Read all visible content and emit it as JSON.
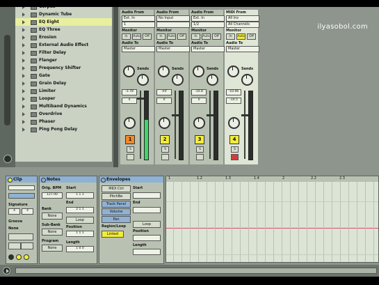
{
  "watermark": "ilyasobol.com",
  "browser": {
    "items": [
      {
        "label": "Corpus"
      },
      {
        "label": "Dynamic Tube"
      },
      {
        "label": "EQ Eight",
        "selected": true
      },
      {
        "label": "EQ Three"
      },
      {
        "label": "Erosion"
      },
      {
        "label": "External Audio Effect"
      },
      {
        "label": "Filter Delay"
      },
      {
        "label": "Flanger"
      },
      {
        "label": "Frequency Shifter"
      },
      {
        "label": "Gate"
      },
      {
        "label": "Grain Delay"
      },
      {
        "label": "Limiter"
      },
      {
        "label": "Looper"
      },
      {
        "label": "Multiband Dynamics"
      },
      {
        "label": "Overdrive"
      },
      {
        "label": "Phaser"
      },
      {
        "label": "Ping Pong Delay"
      }
    ]
  },
  "mixer": {
    "labels": {
      "audio_from": "Audio From",
      "midi_from": "MIDI From",
      "monitor": "Monitor",
      "in": "In",
      "auto": "Auto",
      "off": "Off",
      "audio_to": "Audio To",
      "sends": "Sends",
      "master": "Master",
      "solo": "S"
    },
    "tracks": [
      {
        "from": "Ext. In",
        "channel": "1",
        "volume": "-3.78",
        "pan": "0",
        "number": "1",
        "number_color": "#f08a2b",
        "meter_active": true,
        "selected": false
      },
      {
        "from": "No Input",
        "channel": "",
        "volume": "-Inf",
        "pan": "0",
        "number": "2",
        "number_color": "#f1ec3c",
        "meter_active": false,
        "selected": false
      },
      {
        "from": "Ext. In",
        "channel": "1/2",
        "volume": "-10.8",
        "pan": "0",
        "number": "3",
        "number_color": "#f1ec3c",
        "meter_active": false,
        "selected": false
      },
      {
        "from": "All Ins",
        "channel": "All Channels",
        "volume": "-10.96",
        "pan": "-14.5",
        "number": "4",
        "number_color": "#f1ec3c",
        "meter_active": false,
        "selected": true
      }
    ]
  },
  "clip_panel": {
    "title": "Clip",
    "signature_label": "Signature",
    "signature_num": "4",
    "signature_den": "4",
    "groove_label": "Groove",
    "groove_value": "None"
  },
  "notes_panel": {
    "title": "Notes",
    "orig_bpm_label": "Orig. BPM",
    "bpm_value": "127.00",
    "start_label": "Start",
    "end_label": "End",
    "start_value": "1 1 1",
    "end_value": "2 1 1",
    "bank_label": "Bank",
    "bank_value": "None",
    "loop_label": "Loop",
    "sub_bank_label": "Sub-Bank",
    "sub_bank_value": "None",
    "position_label": "Position",
    "position_value": "1 1 1",
    "program_label": "Program",
    "program_value": "None",
    "length_label": "Length",
    "length_value": "1 0 0"
  },
  "envelopes_panel": {
    "title": "Envelopes",
    "source": "MIDI Ctrl",
    "control": "PitchBe",
    "track_fader": "Track Panel",
    "volume": "Volume",
    "pan": "Pan",
    "start_label": "Start",
    "end_label": "End",
    "loop_label": "Loop",
    "region_label": "Region/Loop",
    "position_label": "Position",
    "linked_label": "Linked",
    "length_label": "Length"
  },
  "ruler": {
    "ticks": [
      "1",
      "1.2",
      "1.3",
      "1.4",
      "2",
      "2.2",
      "2.3"
    ]
  },
  "colors": {
    "clip_title": "#8fb1d4",
    "yellow_button": "#f1ec3c",
    "orange_track": "#f08a2b",
    "envelope_line": "#d64b6a",
    "meter_green": "#3fd66a"
  }
}
